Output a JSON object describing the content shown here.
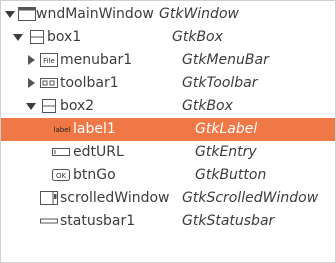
{
  "tree": {
    "rows": [
      {
        "name": "wndMainWindow",
        "type": "GtkWindow"
      },
      {
        "name": "box1",
        "type": "GtkBox"
      },
      {
        "name": "menubar1",
        "type": "GtkMenuBar"
      },
      {
        "name": "toolbar1",
        "type": "GtkToolbar"
      },
      {
        "name": "box2",
        "type": "GtkBox"
      },
      {
        "name": "label1",
        "type": "GtkLabel"
      },
      {
        "name": "edtURL",
        "type": "GtkEntry"
      },
      {
        "name": "btnGo",
        "type": "GtkButton"
      },
      {
        "name": "scrolledWindow",
        "type": "GtkScrolledWindow"
      },
      {
        "name": "statusbar1",
        "type": "GtkStatusbar"
      }
    ],
    "icon_text": {
      "menubar": "File",
      "label": "label"
    },
    "selected_row": 5,
    "colors": {
      "selection": "#f07746",
      "text": "#3c3c3c"
    }
  }
}
